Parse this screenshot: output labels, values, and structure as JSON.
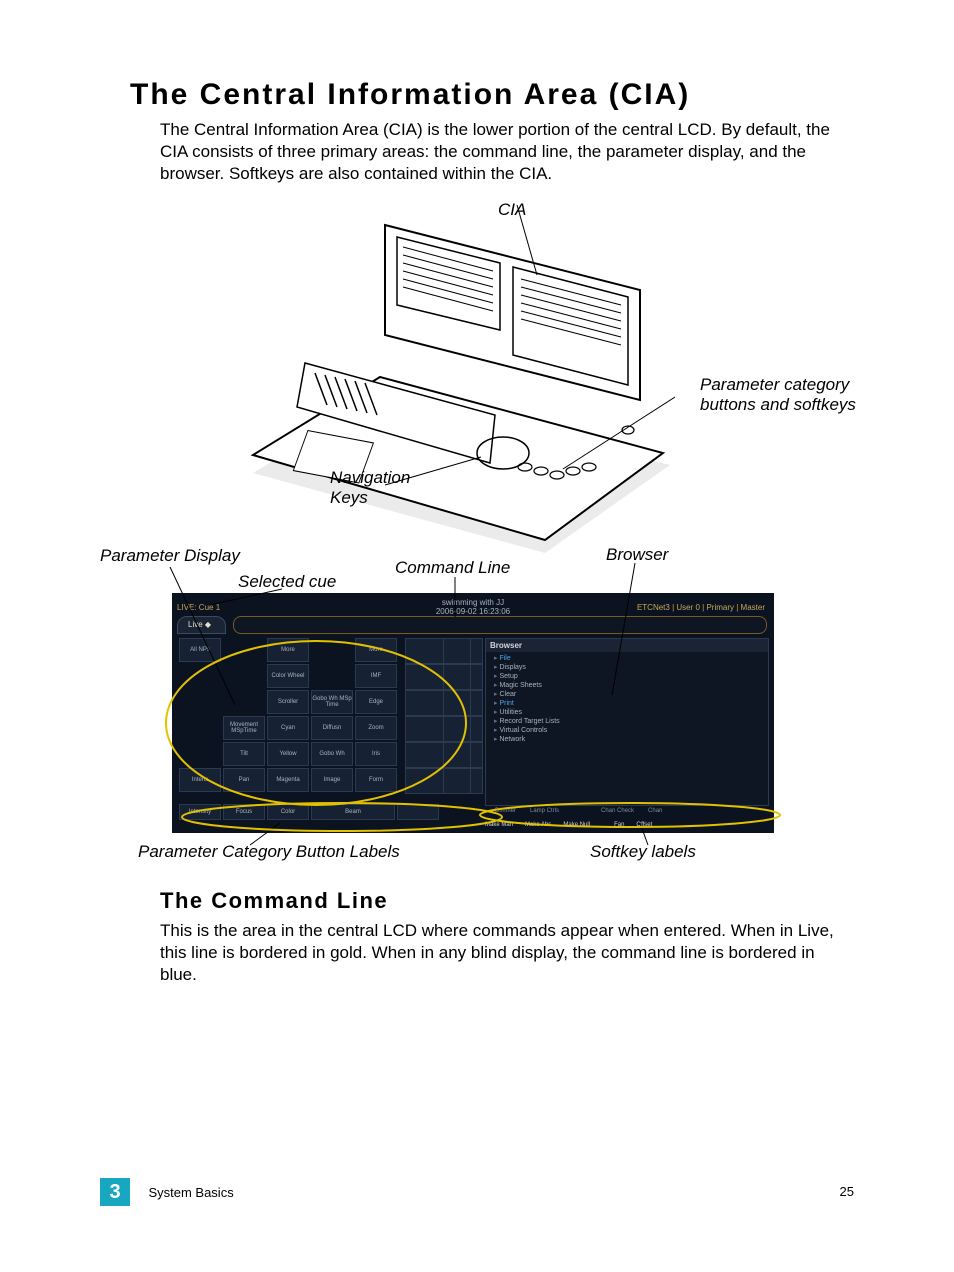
{
  "headings": {
    "h1": "The Central Information Area (CIA)",
    "h2": "The Command Line"
  },
  "paragraphs": {
    "p1": "The Central Information Area (CIA) is the lower portion of the central LCD. By default, the CIA consists of three primary areas: the command line, the parameter display, and the browser. Softkeys are also contained within the CIA.",
    "p2": "This is the area in the central LCD where commands appear when entered. When in Live, this line is bordered in gold. When in any blind display, the command line is bordered in blue."
  },
  "console_callouts": {
    "cia": "CIA",
    "param_buttons": "Parameter category buttons and softkeys",
    "nav_keys": "Navigation Keys"
  },
  "cia_callouts": {
    "param_display": "Parameter Display",
    "selected_cue": "Selected cue",
    "command_line": "Command Line",
    "browser": "Browser",
    "param_cat_labels": "Parameter Category Button Labels",
    "softkey_labels": "Softkey labels"
  },
  "cia_screenshot": {
    "top_left": "LIVE: Cue 1",
    "top_center_line1": "swimming with JJ",
    "top_center_line2": "2006-09-02 16:23:06",
    "top_right": "ETCNet3 | User 0 | Primary | Master",
    "live_tab": "Live ◆",
    "param_grid": [
      [
        "All NPs",
        "",
        "More",
        "",
        "More"
      ],
      [
        "",
        "",
        "Color Wheel",
        "",
        "IMF"
      ],
      [
        "",
        "",
        "Scroller",
        "Gobo Wh MSp Time",
        "Edge"
      ],
      [
        "",
        "Movement MSpTime",
        "Cyan",
        "Diffusn",
        "Zoom"
      ],
      [
        "",
        "Tilt",
        "Yellow",
        "Gobo Wh",
        "Iris"
      ],
      [
        "Intens",
        "Pan",
        "Magenta",
        "Image",
        "Form"
      ]
    ],
    "cat_row": [
      "Intensity",
      "Focus",
      "Color",
      "Beam",
      ""
    ],
    "browser_title": "Browser",
    "browser_items": [
      {
        "label": "File",
        "selected": true
      },
      {
        "label": "Displays"
      },
      {
        "label": "Setup"
      },
      {
        "label": "Magic Sheets"
      },
      {
        "label": "Clear"
      },
      {
        "label": "Print",
        "selected": true
      },
      {
        "label": "Utilities"
      },
      {
        "label": "Record Target Lists"
      },
      {
        "label": "Virtual Controls"
      },
      {
        "label": "Network"
      }
    ],
    "softkeys_line1": [
      "Dimmer",
      "Lamp Ctrls",
      "",
      "",
      "Chan Check",
      "Chan"
    ],
    "softkeys_line2": [
      "Make Man",
      "Make Abs",
      "Make Null",
      "",
      "Fan",
      "Offset"
    ]
  },
  "footer": {
    "chapter": "3",
    "section": "System Basics",
    "page": "25"
  }
}
